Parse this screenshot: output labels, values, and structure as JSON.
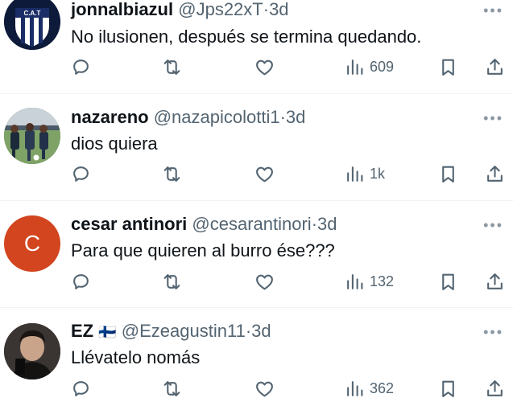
{
  "tweets": [
    {
      "name": "jonnalbiazul",
      "handle": "@Jps22xT",
      "dot": "·",
      "time": "3d",
      "text": "No ilusionen, después se termina quedando.",
      "views": "609",
      "avatar": {
        "type": "crest",
        "label": "C.A.T"
      }
    },
    {
      "name": "nazareno",
      "handle": "@nazapicolotti1",
      "dot": "·",
      "time": "3d",
      "text": "dios quiera",
      "views": "1k",
      "avatar": {
        "type": "photo"
      }
    },
    {
      "name": "cesar antinori",
      "handle": "@cesarantinori",
      "dot": "·",
      "time": "3d",
      "text": "Para que quieren al burro ése???",
      "views": "132",
      "avatar": {
        "type": "letter",
        "letter": "C",
        "color": "#d2451e"
      }
    },
    {
      "name": "EZ",
      "flag": "🇫🇮",
      "handle": "@Ezeagustin11",
      "dot": "·",
      "time": "3d",
      "text": "Llévatelo nomás",
      "views": "362",
      "avatar": {
        "type": "photo"
      }
    }
  ],
  "colors": {
    "text": "#0f1419",
    "secondary": "#536471",
    "divider": "#eff3f4"
  },
  "icons": [
    "reply-icon",
    "retweet-icon",
    "like-icon",
    "views-icon",
    "bookmark-icon",
    "share-icon",
    "more-icon"
  ]
}
